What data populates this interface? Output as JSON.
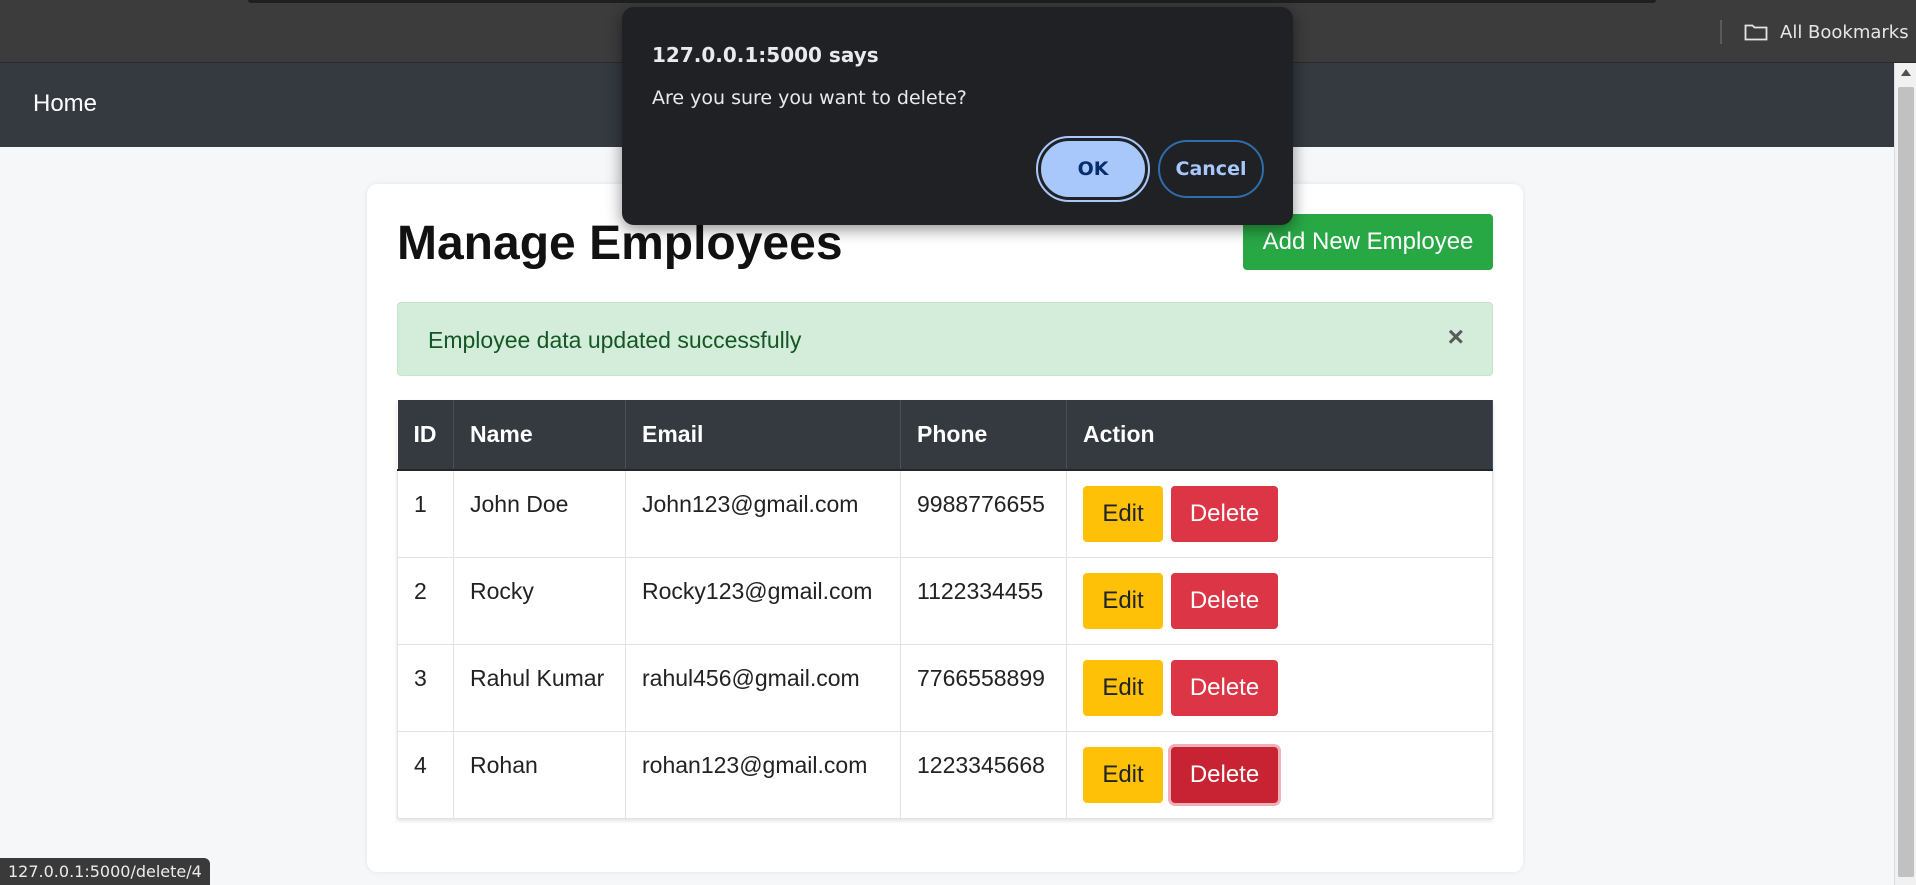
{
  "browser": {
    "bookmarks_label": "All Bookmarks",
    "status_url": "127.0.0.1:5000/delete/4"
  },
  "navbar": {
    "home": "Home"
  },
  "page": {
    "title_prefix": "Manage",
    "title_bold": "Employees",
    "add_button": "Add New Employee"
  },
  "alert": {
    "message": "Employee data updated successfully",
    "close": "×"
  },
  "table": {
    "headers": [
      "ID",
      "Name",
      "Email",
      "Phone",
      "Action"
    ],
    "rows": [
      {
        "id": "1",
        "name": "John Doe",
        "email": "John123@gmail.com",
        "phone": "9988776655"
      },
      {
        "id": "2",
        "name": "Rocky",
        "email": "Rocky123@gmail.com",
        "phone": "1122334455"
      },
      {
        "id": "3",
        "name": "Rahul Kumar",
        "email": "rahul456@gmail.com",
        "phone": "7766558899"
      },
      {
        "id": "4",
        "name": "Rohan",
        "email": "rohan123@gmail.com",
        "phone": "1223345668"
      }
    ],
    "edit_label": "Edit",
    "delete_label": "Delete"
  },
  "dialog": {
    "title": "127.0.0.1:5000 says",
    "message": "Are you sure you want to delete?",
    "ok": "OK",
    "cancel": "Cancel"
  },
  "colors": {
    "navbar": "#343a40",
    "success": "#28a745",
    "warning": "#ffc107",
    "danger": "#dc3545",
    "alert_bg": "#d4edda",
    "dialog_bg": "#202124",
    "dialog_accent": "#a8c7fa"
  }
}
